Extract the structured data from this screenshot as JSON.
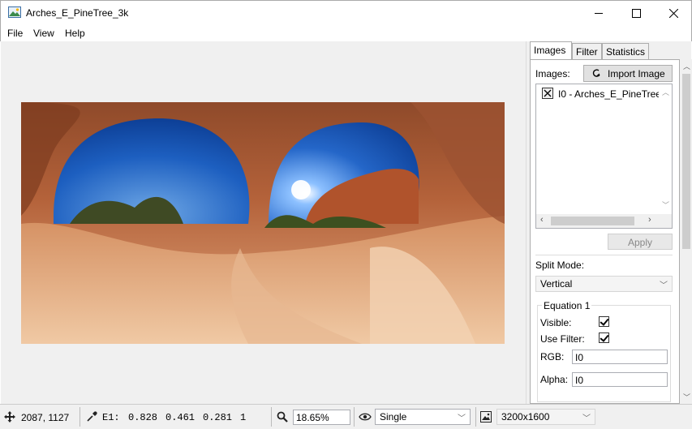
{
  "window": {
    "title": "Arches_E_PineTree_3k"
  },
  "menu": {
    "file": "File",
    "view": "View",
    "help": "Help"
  },
  "tabs": {
    "images": "Images",
    "filter": "Filter",
    "statistics": "Statistics"
  },
  "images_tab": {
    "images_label": "Images:",
    "import_button": "Import Image",
    "list_items": [
      "I0 - Arches_E_PineTree_"
    ],
    "apply_button": "Apply",
    "split_mode_label": "Split Mode:",
    "split_mode_value": "Vertical",
    "equation": {
      "title": "Equation 1",
      "visible_label": "Visible:",
      "use_filter_label": "Use Filter:",
      "rgb_label": "RGB:",
      "rgb_value": "I0",
      "alpha_label": "Alpha:",
      "alpha_value": "I0"
    }
  },
  "status": {
    "cursor_pos": "2087, 1127",
    "pixel_label": "E1:",
    "pixel_r": "0.828",
    "pixel_g": "0.461",
    "pixel_b": "0.281",
    "pixel_a": "1",
    "zoom": "18.65%",
    "view_mode": "Single",
    "image_size": "3200x1600"
  }
}
